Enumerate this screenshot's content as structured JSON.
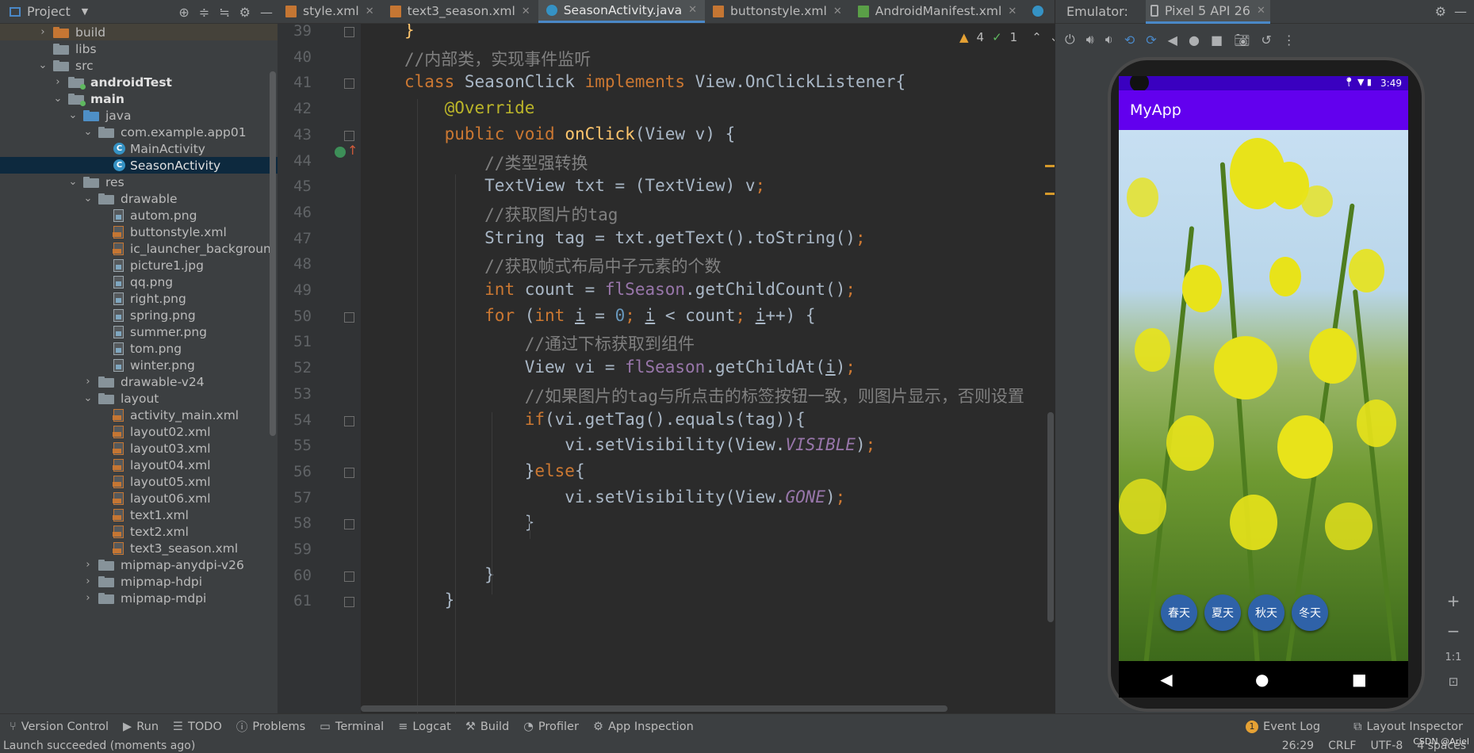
{
  "project_panel": {
    "title": "Project",
    "tree": [
      {
        "label": "build",
        "indent": 1,
        "arrow": "›",
        "icon": "folder-orange",
        "bold": false
      },
      {
        "label": "libs",
        "indent": 1,
        "arrow": "",
        "icon": "folder",
        "bold": false
      },
      {
        "label": "src",
        "indent": 1,
        "arrow": "⌄",
        "icon": "folder",
        "bold": false
      },
      {
        "label": "androidTest",
        "indent": 2,
        "arrow": "›",
        "icon": "folder-green",
        "bold": true
      },
      {
        "label": "main",
        "indent": 2,
        "arrow": "⌄",
        "icon": "folder-green",
        "bold": true
      },
      {
        "label": "java",
        "indent": 3,
        "arrow": "⌄",
        "icon": "folder-blue",
        "bold": false
      },
      {
        "label": "com.example.app01",
        "indent": 4,
        "arrow": "⌄",
        "icon": "package",
        "bold": false
      },
      {
        "label": "MainActivity",
        "indent": 5,
        "arrow": "",
        "icon": "class",
        "bold": false
      },
      {
        "label": "SeasonActivity",
        "indent": 5,
        "arrow": "",
        "icon": "class",
        "bold": false,
        "selected": true
      },
      {
        "label": "res",
        "indent": 3,
        "arrow": "⌄",
        "icon": "folder-res",
        "bold": false
      },
      {
        "label": "drawable",
        "indent": 4,
        "arrow": "⌄",
        "icon": "folder",
        "bold": false
      },
      {
        "label": "autom.png",
        "indent": 5,
        "arrow": "",
        "icon": "image",
        "bold": false
      },
      {
        "label": "buttonstyle.xml",
        "indent": 5,
        "arrow": "",
        "icon": "xml",
        "bold": false
      },
      {
        "label": "ic_launcher_backgroun",
        "indent": 5,
        "arrow": "",
        "icon": "xml",
        "bold": false
      },
      {
        "label": "picture1.jpg",
        "indent": 5,
        "arrow": "",
        "icon": "image",
        "bold": false
      },
      {
        "label": "qq.png",
        "indent": 5,
        "arrow": "",
        "icon": "image",
        "bold": false
      },
      {
        "label": "right.png",
        "indent": 5,
        "arrow": "",
        "icon": "image",
        "bold": false
      },
      {
        "label": "spring.png",
        "indent": 5,
        "arrow": "",
        "icon": "image",
        "bold": false
      },
      {
        "label": "summer.png",
        "indent": 5,
        "arrow": "",
        "icon": "image",
        "bold": false
      },
      {
        "label": "tom.png",
        "indent": 5,
        "arrow": "",
        "icon": "image",
        "bold": false
      },
      {
        "label": "winter.png",
        "indent": 5,
        "arrow": "",
        "icon": "image",
        "bold": false
      },
      {
        "label": "drawable-v24",
        "indent": 4,
        "arrow": "›",
        "icon": "folder",
        "bold": false
      },
      {
        "label": "layout",
        "indent": 4,
        "arrow": "⌄",
        "icon": "folder",
        "bold": false
      },
      {
        "label": "activity_main.xml",
        "indent": 5,
        "arrow": "",
        "icon": "xml",
        "bold": false
      },
      {
        "label": "layout02.xml",
        "indent": 5,
        "arrow": "",
        "icon": "xml",
        "bold": false
      },
      {
        "label": "layout03.xml",
        "indent": 5,
        "arrow": "",
        "icon": "xml",
        "bold": false
      },
      {
        "label": "layout04.xml",
        "indent": 5,
        "arrow": "",
        "icon": "xml",
        "bold": false
      },
      {
        "label": "layout05.xml",
        "indent": 5,
        "arrow": "",
        "icon": "xml",
        "bold": false
      },
      {
        "label": "layout06.xml",
        "indent": 5,
        "arrow": "",
        "icon": "xml",
        "bold": false
      },
      {
        "label": "text1.xml",
        "indent": 5,
        "arrow": "",
        "icon": "xml",
        "bold": false
      },
      {
        "label": "text2.xml",
        "indent": 5,
        "arrow": "",
        "icon": "xml",
        "bold": false
      },
      {
        "label": "text3_season.xml",
        "indent": 5,
        "arrow": "",
        "icon": "xml",
        "bold": false
      },
      {
        "label": "mipmap-anydpi-v26",
        "indent": 4,
        "arrow": "›",
        "icon": "folder",
        "bold": false
      },
      {
        "label": "mipmap-hdpi",
        "indent": 4,
        "arrow": "›",
        "icon": "folder",
        "bold": false
      },
      {
        "label": "mipmap-mdpi",
        "indent": 4,
        "arrow": "›",
        "icon": "folder",
        "bold": false
      }
    ]
  },
  "editor_tabs": [
    {
      "label": "style.xml",
      "icon": "xml",
      "active": false
    },
    {
      "label": "text3_season.xml",
      "icon": "xml",
      "active": false
    },
    {
      "label": "SeasonActivity.java",
      "icon": "class",
      "active": true
    },
    {
      "label": "buttonstyle.xml",
      "icon": "xml",
      "active": false
    },
    {
      "label": "AndroidManifest.xml",
      "icon": "manifest",
      "active": false
    }
  ],
  "inspections": {
    "warnings": "4",
    "typos": "1"
  },
  "code_lines": [
    {
      "n": "39",
      "html": "<span class='fn'>}</span>"
    },
    {
      "n": "40",
      "html": "<span class='cm'>//内部类，实现事件监听</span>"
    },
    {
      "n": "41",
      "html": "<span class='kw'>class</span> SeasonClick <span class='kw'>implements</span> View.OnClickListener{"
    },
    {
      "n": "42",
      "html": "    <span class='an'>@Override</span>"
    },
    {
      "n": "43",
      "html": "    <span class='kw'>public void</span> <span class='fn'>onClick</span>(View v) {"
    },
    {
      "n": "44",
      "html": "        <span class='cm'>//类型强转换</span>"
    },
    {
      "n": "45",
      "html": "        TextView txt = (TextView) v<span class='kw'>;</span>"
    },
    {
      "n": "46",
      "html": "        <span class='cm'>//获取图片的tag</span>"
    },
    {
      "n": "47",
      "html": "        String tag = txt.getText().toString()<span class='kw'>;</span>"
    },
    {
      "n": "48",
      "html": "        <span class='cm'>//获取帧式布局中子元素的个数</span>"
    },
    {
      "n": "49",
      "html": "        <span class='kw'>int</span> count = <span class='fd'>flSeason</span>.getChildCount()<span class='kw'>;</span>"
    },
    {
      "n": "50",
      "html": "        <span class='kw'>for</span> (<span class='kw'>int</span> <span class='ul'>i</span> = <span class='num'>0</span><span class='kw'>;</span> <span class='ul'>i</span> &lt; count<span class='kw'>;</span> <span class='ul'>i</span>++) {"
    },
    {
      "n": "51",
      "html": "            <span class='cm'>//通过下标获取到组件</span>"
    },
    {
      "n": "52",
      "html": "            View vi = <span class='fd'>flSeason</span>.getChildAt(<span class='ul'>i</span>)<span class='kw'>;</span>"
    },
    {
      "n": "53",
      "html": "            <span class='cm'>//如果图片的tag与所点击的标签按钮一致，则图片显示，否则设置</span>"
    },
    {
      "n": "54",
      "html": "            <span class='kw'>if</span>(vi.getTag().equals(tag)){"
    },
    {
      "n": "55",
      "html": "                vi.setVisibility(View.<span class='it'>VISIBLE</span>)<span class='kw'>;</span>"
    },
    {
      "n": "56",
      "html": "            }<span class='kw'>else</span>{"
    },
    {
      "n": "57",
      "html": "                vi.setVisibility(View.<span class='it'>GONE</span>)<span class='kw'>;</span>"
    },
    {
      "n": "58",
      "html": "            }"
    },
    {
      "n": "59",
      "html": ""
    },
    {
      "n": "60",
      "html": "        }"
    },
    {
      "n": "61",
      "html": "    }"
    }
  ],
  "emulator": {
    "label": "Emulator:",
    "device": "Pixel 5 API 26",
    "status_time": "3:49",
    "app_title": "MyApp",
    "season_buttons": [
      "春天",
      "夏天",
      "秋天",
      "冬天"
    ],
    "zoom_ratio": "1:1"
  },
  "bottom_tools": [
    {
      "label": "Version Control",
      "icon": "branch-icon"
    },
    {
      "label": "Run",
      "icon": "run-icon"
    },
    {
      "label": "TODO",
      "icon": "list-icon"
    },
    {
      "label": "Problems",
      "icon": "problems-icon"
    },
    {
      "label": "Terminal",
      "icon": "terminal-icon"
    },
    {
      "label": "Logcat",
      "icon": "logcat-icon"
    },
    {
      "label": "Build",
      "icon": "hammer-icon"
    },
    {
      "label": "Profiler",
      "icon": "profiler-icon"
    },
    {
      "label": "App Inspection",
      "icon": "inspection-icon"
    }
  ],
  "bottom_right": {
    "event_log": "Event Log",
    "event_count": "1",
    "layout_inspector": "Layout Inspector"
  },
  "status": {
    "message": "Launch succeeded (moments ago)",
    "position": "26:29",
    "line_sep": "CRLF",
    "encoding": "UTF-8",
    "indent": "4 spaces",
    "watermark": "CSDN @Ariel"
  }
}
